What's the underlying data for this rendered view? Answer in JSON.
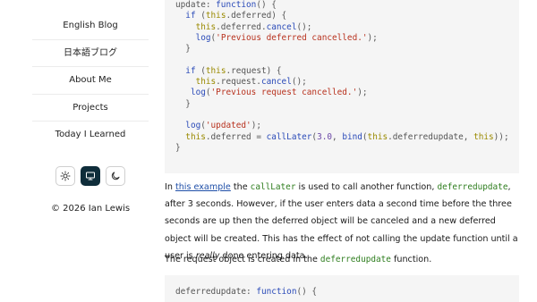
{
  "sidebar": {
    "items": [
      {
        "label": "English Blog"
      },
      {
        "label": "日本語ブログ"
      },
      {
        "label": "About Me"
      },
      {
        "label": "Projects"
      },
      {
        "label": "Today I Learned"
      }
    ],
    "theme_buttons": [
      {
        "icon": "sun-icon",
        "active": false
      },
      {
        "icon": "monitor-icon",
        "active": true
      },
      {
        "icon": "moon-icon",
        "active": false
      }
    ],
    "copyright": "© 2026 Ian Lewis"
  },
  "code_top": [
    [
      [
        "p",
        "update: "
      ],
      [
        "kw",
        "function"
      ],
      [
        "p",
        "() {"
      ]
    ],
    [
      [
        "p",
        "  "
      ],
      [
        "kw",
        "if"
      ],
      [
        "p",
        " ("
      ],
      [
        "t",
        "this"
      ],
      [
        "p",
        ".deferred) {"
      ]
    ],
    [
      [
        "p",
        "    "
      ],
      [
        "t",
        "this"
      ],
      [
        "p",
        ".deferred."
      ],
      [
        "fn",
        "cancel"
      ],
      [
        "p",
        "();"
      ]
    ],
    [
      [
        "p",
        "    "
      ],
      [
        "fn",
        "log"
      ],
      [
        "p",
        "("
      ],
      [
        "s",
        "'Previous deferred cancelled.'"
      ],
      [
        "p",
        ");"
      ]
    ],
    [
      [
        "p",
        "  }"
      ]
    ],
    [
      [
        "p",
        ""
      ]
    ],
    [
      [
        "p",
        "  "
      ],
      [
        "kw",
        "if"
      ],
      [
        "p",
        " ("
      ],
      [
        "t",
        "this"
      ],
      [
        "p",
        ".request) {"
      ]
    ],
    [
      [
        "p",
        "    "
      ],
      [
        "t",
        "this"
      ],
      [
        "p",
        ".request."
      ],
      [
        "fn",
        "cancel"
      ],
      [
        "p",
        "();"
      ]
    ],
    [
      [
        "p",
        "   "
      ],
      [
        "fn",
        "log"
      ],
      [
        "p",
        "("
      ],
      [
        "s",
        "'Previous request cancelled.'"
      ],
      [
        "p",
        ");"
      ]
    ],
    [
      [
        "p",
        "  }"
      ]
    ],
    [
      [
        "p",
        ""
      ]
    ],
    [
      [
        "p",
        "  "
      ],
      [
        "fn",
        "log"
      ],
      [
        "p",
        "("
      ],
      [
        "s",
        "'updated'"
      ],
      [
        "p",
        ");"
      ]
    ],
    [
      [
        "p",
        "  "
      ],
      [
        "t",
        "this"
      ],
      [
        "p",
        ".deferred = "
      ],
      [
        "fn",
        "callLater"
      ],
      [
        "p",
        "("
      ],
      [
        "n",
        "3.0"
      ],
      [
        "p",
        ", "
      ],
      [
        "fn",
        "bind"
      ],
      [
        "p",
        "("
      ],
      [
        "t",
        "this"
      ],
      [
        "p",
        ".deferredupdate, "
      ],
      [
        "t",
        "this"
      ],
      [
        "p",
        "));"
      ]
    ],
    [
      [
        "p",
        "}"
      ]
    ]
  ],
  "paragraph1": {
    "pre": "In ",
    "link": "this example",
    "mid1": " the ",
    "code1": "callLater",
    "mid2": " is used to call another function, ",
    "code2": "deferredupdate",
    "mid3": ", after 3 seconds. However, if the user enters data a second time before the three seconds are up then the deferred object will be canceled and a new deferred object will be created. This has the effect of not calling the update function until a user is ",
    "em": "really",
    "post": " done entering data."
  },
  "paragraph2": {
    "pre": "The request object is created in the ",
    "code": "deferredupdate",
    "post": " function."
  },
  "code_bottom": [
    [
      [
        "p",
        "deferredupdate: "
      ],
      [
        "kw",
        "function"
      ],
      [
        "p",
        "() {"
      ]
    ]
  ]
}
